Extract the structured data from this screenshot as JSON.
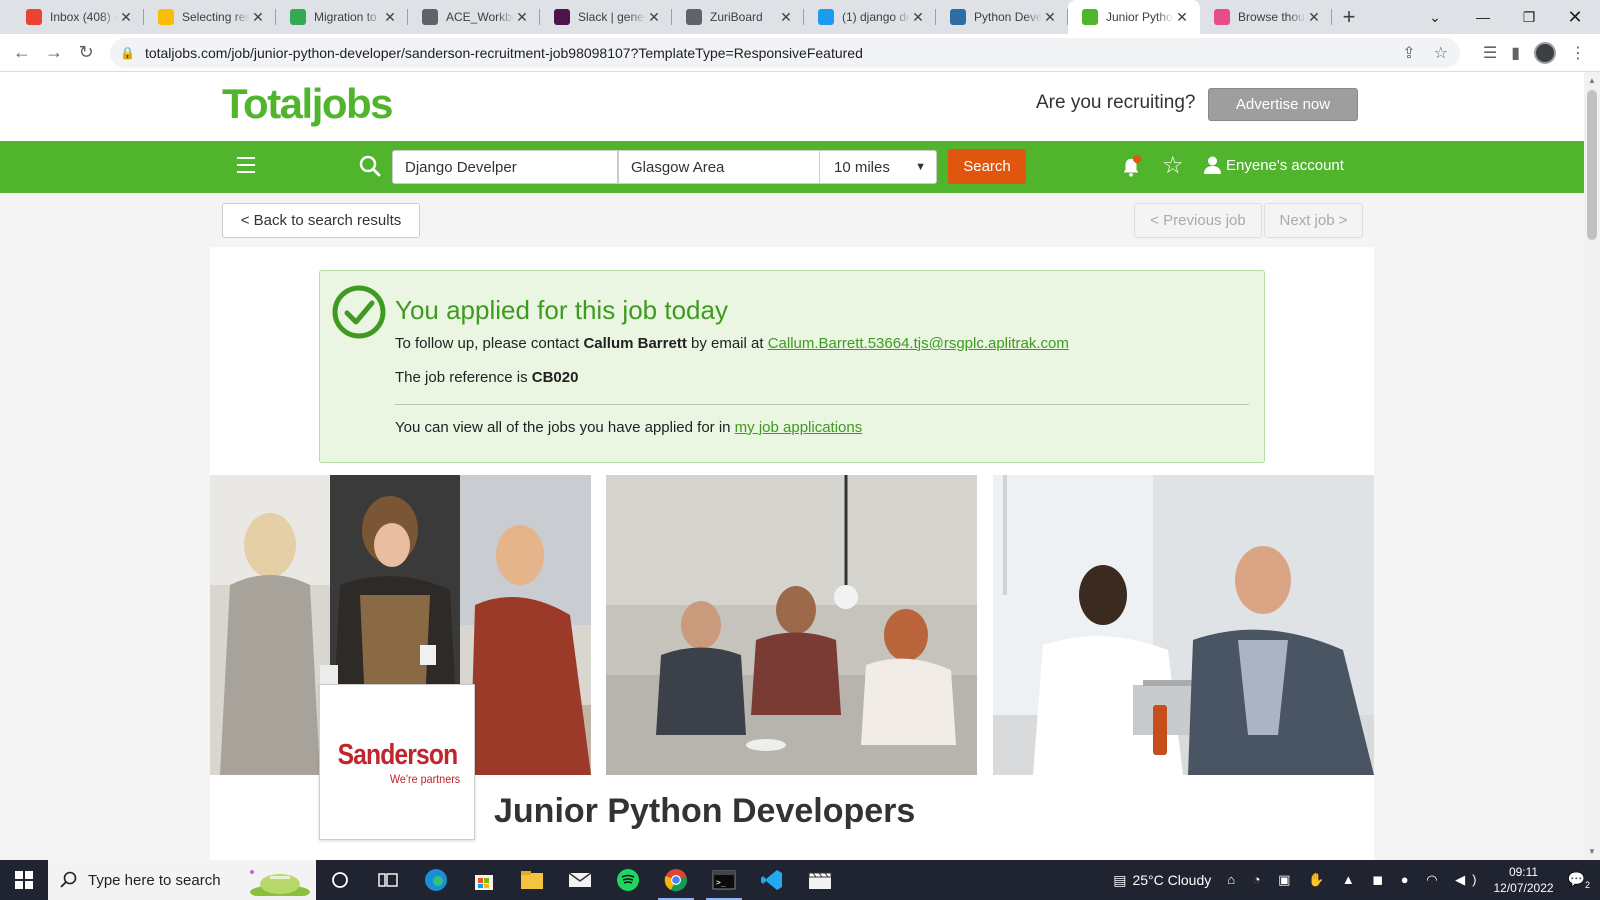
{
  "browser": {
    "tabs": [
      {
        "title": "Inbox (408) -",
        "favicon": "gmail-icon",
        "color": "#ea4335"
      },
      {
        "title": "Selecting res",
        "favicon": "drive-icon",
        "color": "#fbbc04"
      },
      {
        "title": "Migration to",
        "favicon": "drive-icon",
        "color": "#34a853"
      },
      {
        "title": "ACE_Workbo",
        "favicon": "globe-icon",
        "color": "#5f6368"
      },
      {
        "title": "Slack | gener",
        "favicon": "slack-icon",
        "color": "#4a154b"
      },
      {
        "title": "ZuriBoard",
        "favicon": "globe-icon",
        "color": "#5f6368"
      },
      {
        "title": "(1) django de",
        "favicon": "twitter-icon",
        "color": "#1d9bf0"
      },
      {
        "title": "Python Deve",
        "favicon": "wellfound-icon",
        "color": "#2d6da3"
      },
      {
        "title": "Junior Pytho",
        "favicon": "totaljobs-icon",
        "color": "#50b42d",
        "active": true
      },
      {
        "title": "Browse thou",
        "favicon": "dribbble-icon",
        "color": "#ea4c89"
      }
    ],
    "url": "totaljobs.com/job/junior-python-developer/sanderson-recruitment-job98098107?TemplateType=ResponsiveFeatured"
  },
  "site": {
    "logo": "Totaljobs",
    "recruiting_question": "Are you recruiting?",
    "advertise_label": "Advertise now",
    "search": {
      "keywords": "Django Develper",
      "location": "Glasgow Area",
      "radius": "10 miles",
      "button": "Search"
    },
    "account_label": "Enyene's account",
    "nav": {
      "back": "< Back to search results",
      "previous": "< Previous job",
      "next": "Next job >"
    }
  },
  "application": {
    "heading": "You applied for this job today",
    "contact_prefix": "To follow up, please contact ",
    "contact_name": "Callum Barrett",
    "contact_mid": " by email at ",
    "contact_email": "Callum.Barrett.53664.tjs@rsgplc.aplitrak.com",
    "reference_prefix": "The job reference is ",
    "reference": "CB020",
    "view_prefix": "You can view all of the jobs you have applied for in ",
    "view_link": "my job applications"
  },
  "job": {
    "company_logo_name": "Sanderson",
    "company_logo_tag": "We're partners",
    "title": "Junior Python Developers"
  },
  "taskbar": {
    "search_placeholder": "Type here to search",
    "weather": "25°C  Cloudy",
    "time": "09:11",
    "date": "12/07/2022",
    "notifications": "2"
  },
  "colors": {
    "brand_green": "#50b42d",
    "search_orange": "#e0560f",
    "applied_bg": "#eaf5e2",
    "logo_red": "#c0252c"
  }
}
